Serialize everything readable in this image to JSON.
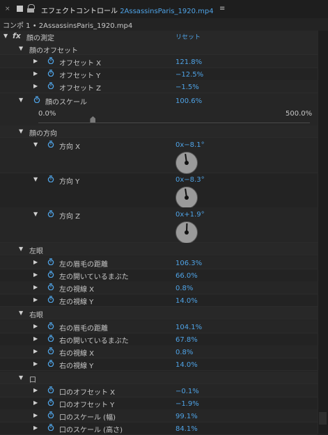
{
  "header": {
    "title_prefix": "エフェクトコントロール",
    "title_file": "2AssassinsParis_1920.mp4",
    "menu_icon": "≡",
    "close_icon": "×"
  },
  "breadcrumb": "コンポ 1 • 2AssassinsParis_1920.mp4",
  "effect": {
    "fx": "fx",
    "name": "顔の測定",
    "reset": "リセット"
  },
  "groups": {
    "offset": "顔のオフセット",
    "direction": "顔の方向",
    "left_eye": "左眼",
    "right_eye": "右眼",
    "mouth": "口"
  },
  "offset_props": [
    {
      "label": "オフセット X",
      "value": "121.8%"
    },
    {
      "label": "オフセット Y",
      "value": "−12.5%"
    },
    {
      "label": "オフセット Z",
      "value": "−1.5%"
    }
  ],
  "scale": {
    "label": "顔のスケール",
    "value": "100.6%",
    "min": "0.0%",
    "max": "500.0%",
    "level": 0.2012
  },
  "direction_props": [
    {
      "label": "方向 X",
      "value": "0x−8.1°",
      "angle": -8.1
    },
    {
      "label": "方向 Y",
      "value": "0x−8.3°",
      "angle": -8.3
    },
    {
      "label": "方向 Z",
      "value": "0x+1.9°",
      "angle": 1.9
    }
  ],
  "left_eye_props": [
    {
      "label": "左の眉毛の距離",
      "value": "106.3%"
    },
    {
      "label": "左の開いているまぶた",
      "value": "66.0%"
    },
    {
      "label": "左の視線 X",
      "value": "0.8%"
    },
    {
      "label": "左の視線 Y",
      "value": "14.0%"
    }
  ],
  "right_eye_props": [
    {
      "label": "右の眉毛の距離",
      "value": "104.1%"
    },
    {
      "label": "右の開いているまぶた",
      "value": "67.8%"
    },
    {
      "label": "右の視線 X",
      "value": "0.8%"
    },
    {
      "label": "右の視線 Y",
      "value": "14.0%"
    }
  ],
  "mouth_props": [
    {
      "label": "口のオフセット X",
      "value": "−0.1%"
    },
    {
      "label": "口のオフセット Y",
      "value": "−1.9%"
    },
    {
      "label": "口のスケール (幅)",
      "value": "99.1%"
    },
    {
      "label": "口のスケール (高さ)",
      "value": "84.1%"
    }
  ],
  "colors": {
    "value_blue": "#4fa3e6",
    "stopwatch": "#4fa3e6",
    "dial": "#9a9a9a",
    "bg": "#232323"
  }
}
